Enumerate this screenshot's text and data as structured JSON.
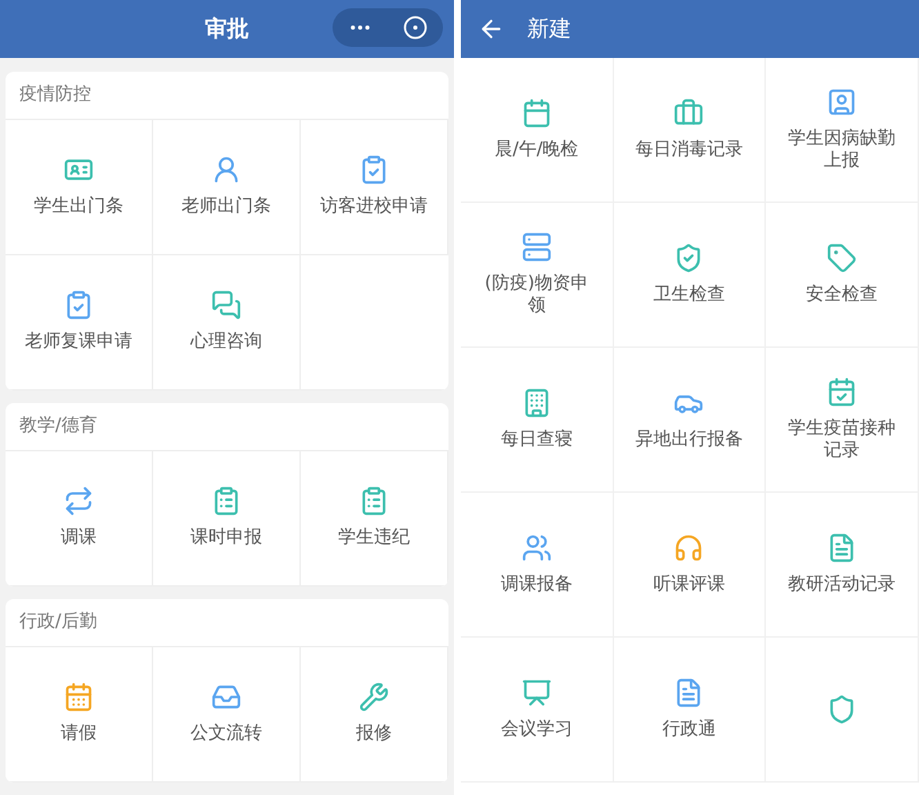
{
  "approval_screen": {
    "title": "审批",
    "sections": [
      {
        "title": "疫情防控",
        "items": [
          {
            "label": "学生出门条"
          },
          {
            "label": "老师出门条"
          },
          {
            "label": "访客进校申请"
          },
          {
            "label": "老师复课申请"
          },
          {
            "label": "心理咨询"
          }
        ]
      },
      {
        "title": "教学/德育",
        "items": [
          {
            "label": "调课"
          },
          {
            "label": "课时申报"
          },
          {
            "label": "学生违纪"
          }
        ]
      },
      {
        "title": "行政/后勤",
        "items": [
          {
            "label": "请假"
          },
          {
            "label": "公文流转"
          },
          {
            "label": "报修"
          }
        ]
      }
    ]
  },
  "new_screen": {
    "title": "新建",
    "items": [
      {
        "label": "晨/午/晚检"
      },
      {
        "label": "每日消毒记录"
      },
      {
        "label": "学生因病缺勤上报"
      },
      {
        "label": "(防疫)物资申领"
      },
      {
        "label": "卫生检查"
      },
      {
        "label": "安全检查"
      },
      {
        "label": "每日查寝"
      },
      {
        "label": "异地出行报备"
      },
      {
        "label": "学生疫苗接种记录"
      },
      {
        "label": "调课报备"
      },
      {
        "label": "听课评课"
      },
      {
        "label": "教研活动记录"
      },
      {
        "label": "会议学习"
      },
      {
        "label": "行政通"
      }
    ]
  }
}
